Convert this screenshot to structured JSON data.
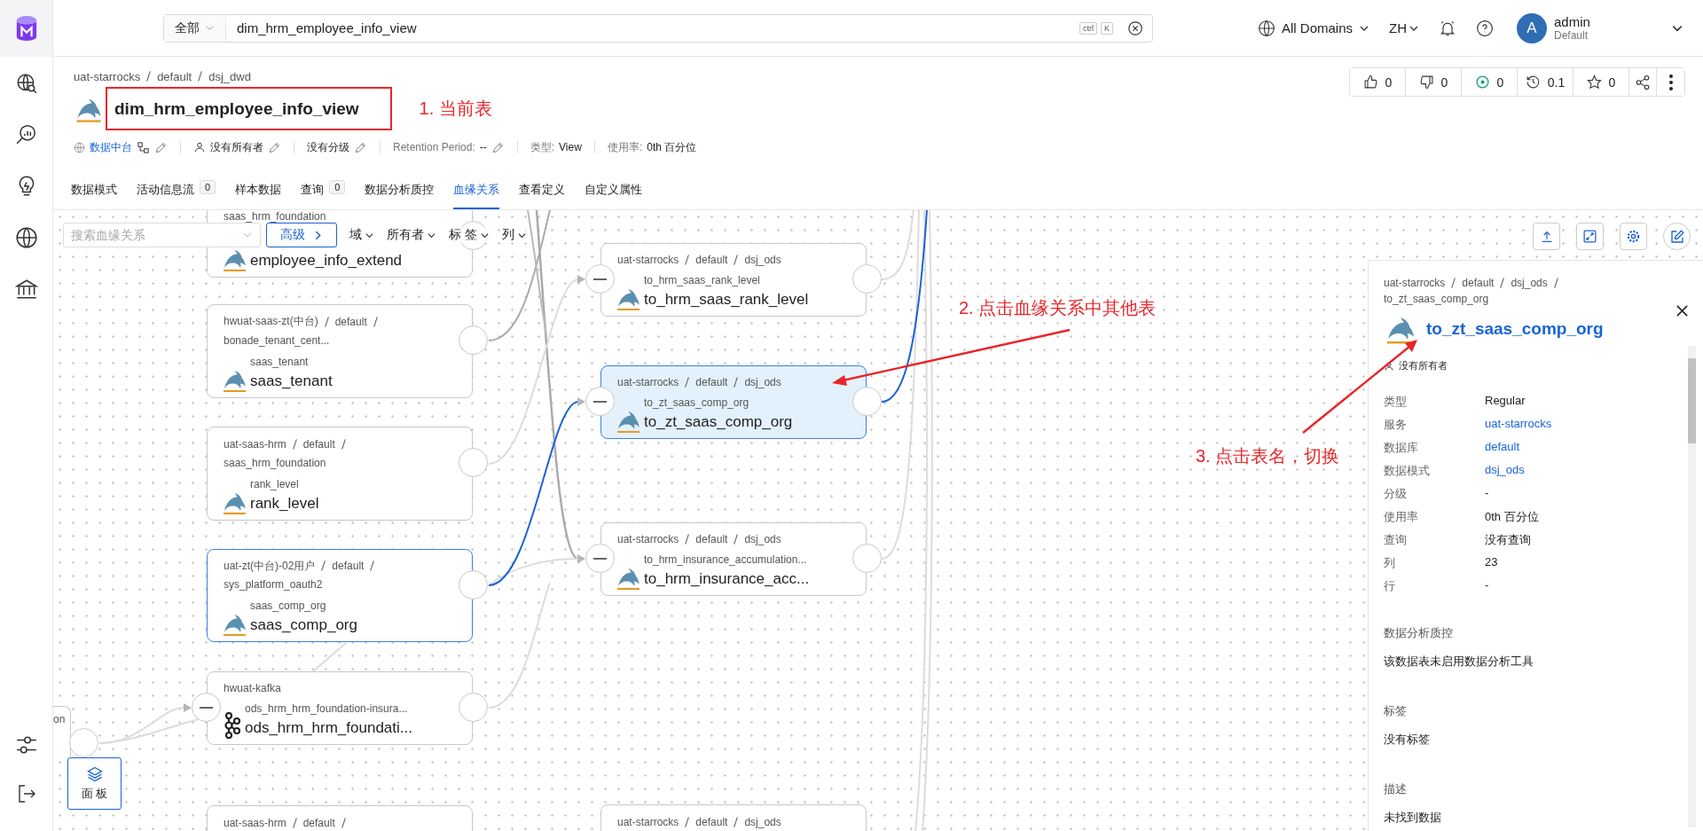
{
  "topbar": {
    "scope": "全部",
    "search": "dim_hrm_employee_info_view",
    "shortcut": [
      "ctrl",
      "K"
    ],
    "domain": "All Domains",
    "language": "ZH",
    "user": {
      "initial": "A",
      "name": "admin",
      "role": "Default"
    }
  },
  "entity": {
    "breadcrumb": [
      "uat-starrocks",
      "default",
      "dsj_dwd"
    ],
    "name": "dim_hrm_employee_info_view",
    "meta": [
      {
        "kind": "domain",
        "value": "数据中台"
      },
      {
        "kind": "owner",
        "value": "没有所有者"
      },
      {
        "kind": "tier",
        "value": "没有分级"
      },
      {
        "kind": "retention",
        "label": "Retention Period:",
        "value": "--"
      },
      {
        "kind": "type",
        "label": "类型:",
        "value": "View"
      },
      {
        "kind": "usage",
        "label": "使用率:",
        "value": "0th 百分位"
      }
    ],
    "actions": [
      {
        "kind": "like",
        "count": "0"
      },
      {
        "kind": "dislike",
        "count": "0"
      },
      {
        "kind": "follow",
        "count": "0"
      },
      {
        "kind": "version",
        "count": "0.1"
      },
      {
        "kind": "star",
        "count": "0"
      },
      {
        "kind": "share"
      },
      {
        "kind": "more"
      }
    ]
  },
  "tabs": [
    {
      "label": "数据模式",
      "selected": false
    },
    {
      "label": "活动信息流",
      "badge": "0",
      "selected": false
    },
    {
      "label": "样本数据",
      "selected": false
    },
    {
      "label": "查询",
      "badge": "0",
      "selected": false
    },
    {
      "label": "数据分析质控",
      "selected": false
    },
    {
      "label": "血缘关系",
      "selected": true
    },
    {
      "label": "查看定义",
      "selected": false
    },
    {
      "label": "自定义属性",
      "selected": false
    }
  ],
  "lineage": {
    "search": {
      "placeholder": "搜索血缘关系"
    },
    "advanced": "高级",
    "filters": [
      "域",
      "所有者",
      "标 签",
      "列"
    ],
    "tools": [
      {
        "kind": "export"
      },
      {
        "kind": "fit"
      },
      {
        "kind": "settings"
      },
      {
        "kind": "edit"
      }
    ],
    "panel_button": "面 板",
    "partial_node": "on",
    "nodes": [
      {
        "kind": "mysql",
        "schema": "saas_hrm_foundation",
        "name": "employee_info_extend",
        "selected": false,
        "highlighted": false,
        "collapsible": false,
        "expandable": true
      },
      {
        "kind": "mysql",
        "path": [
          "hwuat-saas-zt(中台)",
          "default"
        ],
        "wrapped": true,
        "schema": "bonade_tenant_cent...",
        "table": "saas_tenant",
        "name": "saas_tenant",
        "selected": false,
        "highlighted": false,
        "collapsible": false,
        "expandable": true
      },
      {
        "kind": "mysql",
        "path": [
          "uat-saas-hrm",
          "default"
        ],
        "wrapped": true,
        "schema": "saas_hrm_foundation",
        "table": "rank_level",
        "name": "rank_level",
        "selected": false,
        "highlighted": false,
        "collapsible": false,
        "expandable": true
      },
      {
        "kind": "mysql",
        "path": [
          "uat-zt(中台)-02用户",
          "default"
        ],
        "wrapped": true,
        "schema": "sys_platform_oauth2",
        "table": "saas_comp_org",
        "name": "saas_comp_org",
        "selected": false,
        "highlighted": true,
        "collapsible": false,
        "expandable": true
      },
      {
        "kind": "kafka",
        "path": [
          "hwuat-kafka"
        ],
        "wrapped": false,
        "table": "ods_hrm_hrm_foundation-insura...",
        "name": "ods_hrm_hrm_foundati...",
        "selected": false,
        "highlighted": false,
        "collapsible": true,
        "expandable": true
      },
      {
        "path": [
          "uat-saas-hrm",
          "default"
        ],
        "wrapped": true,
        "selected": false,
        "highlighted": false
      },
      {
        "kind": "mysql",
        "path": [
          "uat-starrocks",
          "default",
          "dsj_ods"
        ],
        "wrapped": false,
        "table": "to_hrm_saas_rank_level",
        "name": "to_hrm_saas_rank_level",
        "selected": false,
        "highlighted": false,
        "collapsible": true,
        "expandable": true
      },
      {
        "kind": "mysql",
        "path": [
          "uat-starrocks",
          "default",
          "dsj_ods"
        ],
        "wrapped": false,
        "table": "to_zt_saas_comp_org",
        "name": "to_zt_saas_comp_org",
        "selected": true,
        "highlighted": false,
        "collapsible": true,
        "expandable": true
      },
      {
        "kind": "mysql",
        "path": [
          "uat-starrocks",
          "default",
          "dsj_ods"
        ],
        "wrapped": false,
        "table": "to_hrm_insurance_accumulation...",
        "name": "to_hrm_insurance_acc...",
        "selected": false,
        "highlighted": false,
        "collapsible": true,
        "expandable": true
      },
      {
        "path": [
          "uat-starrocks",
          "default",
          "dsj_ods"
        ],
        "wrapped": false,
        "selected": false,
        "highlighted": false
      }
    ]
  },
  "panel": {
    "breadcrumb": [
      "uat-starrocks",
      "default",
      "dsj_ods",
      "to_zt_saas_comp_org"
    ],
    "title": "to_zt_saas_comp_org",
    "owner": "没有所有者",
    "properties": [
      {
        "label": "类型",
        "value": "Regular",
        "link": false
      },
      {
        "label": "服务",
        "value": "uat-starrocks",
        "link": true
      },
      {
        "label": "数据库",
        "value": "default",
        "link": true
      },
      {
        "label": "数据模式",
        "value": "dsj_ods",
        "link": true
      },
      {
        "label": "分级",
        "value": "-",
        "link": false
      },
      {
        "label": "使用率",
        "value": "0th 百分位",
        "link": false
      },
      {
        "label": "查询",
        "value": "没有查询",
        "link": false
      },
      {
        "label": "列",
        "value": "23",
        "link": false
      },
      {
        "label": "行",
        "value": "-",
        "link": false
      }
    ],
    "sections": [
      {
        "heading": "数据分析质控",
        "text": "该数据表未启用数据分析工具"
      },
      {
        "heading": "标签",
        "text": "没有标签"
      },
      {
        "heading": "描述",
        "text": "未找到数据"
      }
    ]
  },
  "annotations": [
    "1. 当前表",
    "2. 点击血缘关系中其他表",
    "3. 点击表名，切换"
  ]
}
